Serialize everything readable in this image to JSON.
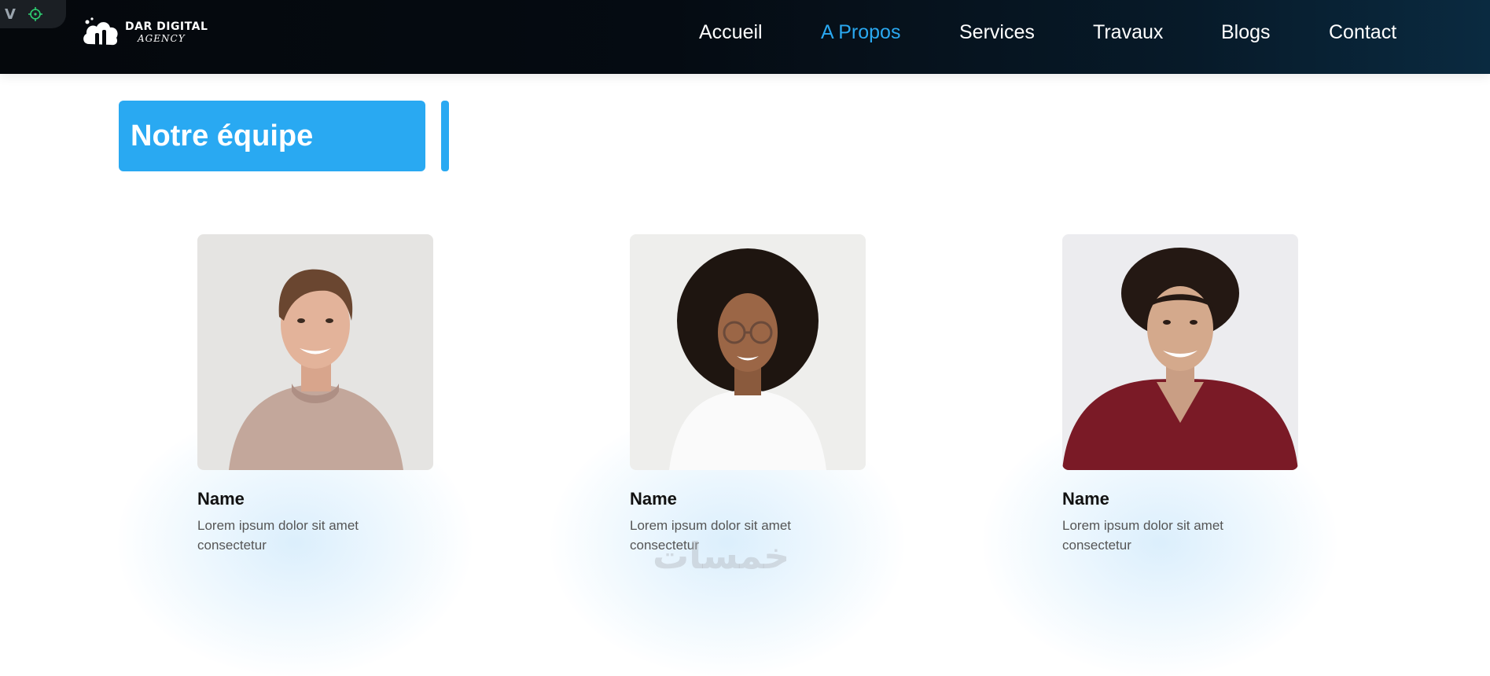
{
  "header": {
    "logo": {
      "line1": "DAR DIGITAL",
      "line2": "AGENCY"
    },
    "dev_toolbar": {
      "letter": "V"
    },
    "nav": [
      {
        "label": "Accueil",
        "active": false
      },
      {
        "label": "A Propos",
        "active": true
      },
      {
        "label": "Services",
        "active": false
      },
      {
        "label": "Travaux",
        "active": false
      },
      {
        "label": "Blogs",
        "active": false
      },
      {
        "label": "Contact",
        "active": false
      }
    ]
  },
  "section": {
    "title": "Notre équipe"
  },
  "team": [
    {
      "name": "Name",
      "description": "Lorem ipsum dolor sit amet consectetur",
      "photo": "man-beige-sweater"
    },
    {
      "name": "Name",
      "description": "Lorem ipsum dolor sit amet consectetur",
      "photo": "woman-curly-glasses"
    },
    {
      "name": "Name",
      "description": "Lorem ipsum dolor sit amet consectetur",
      "photo": "man-curly-maroon-shirt"
    }
  ],
  "watermark": "خمسات",
  "colors": {
    "accent": "#29a9f2",
    "header_bg": "#050b12",
    "text_dark": "#111111",
    "text_muted": "#555555"
  }
}
